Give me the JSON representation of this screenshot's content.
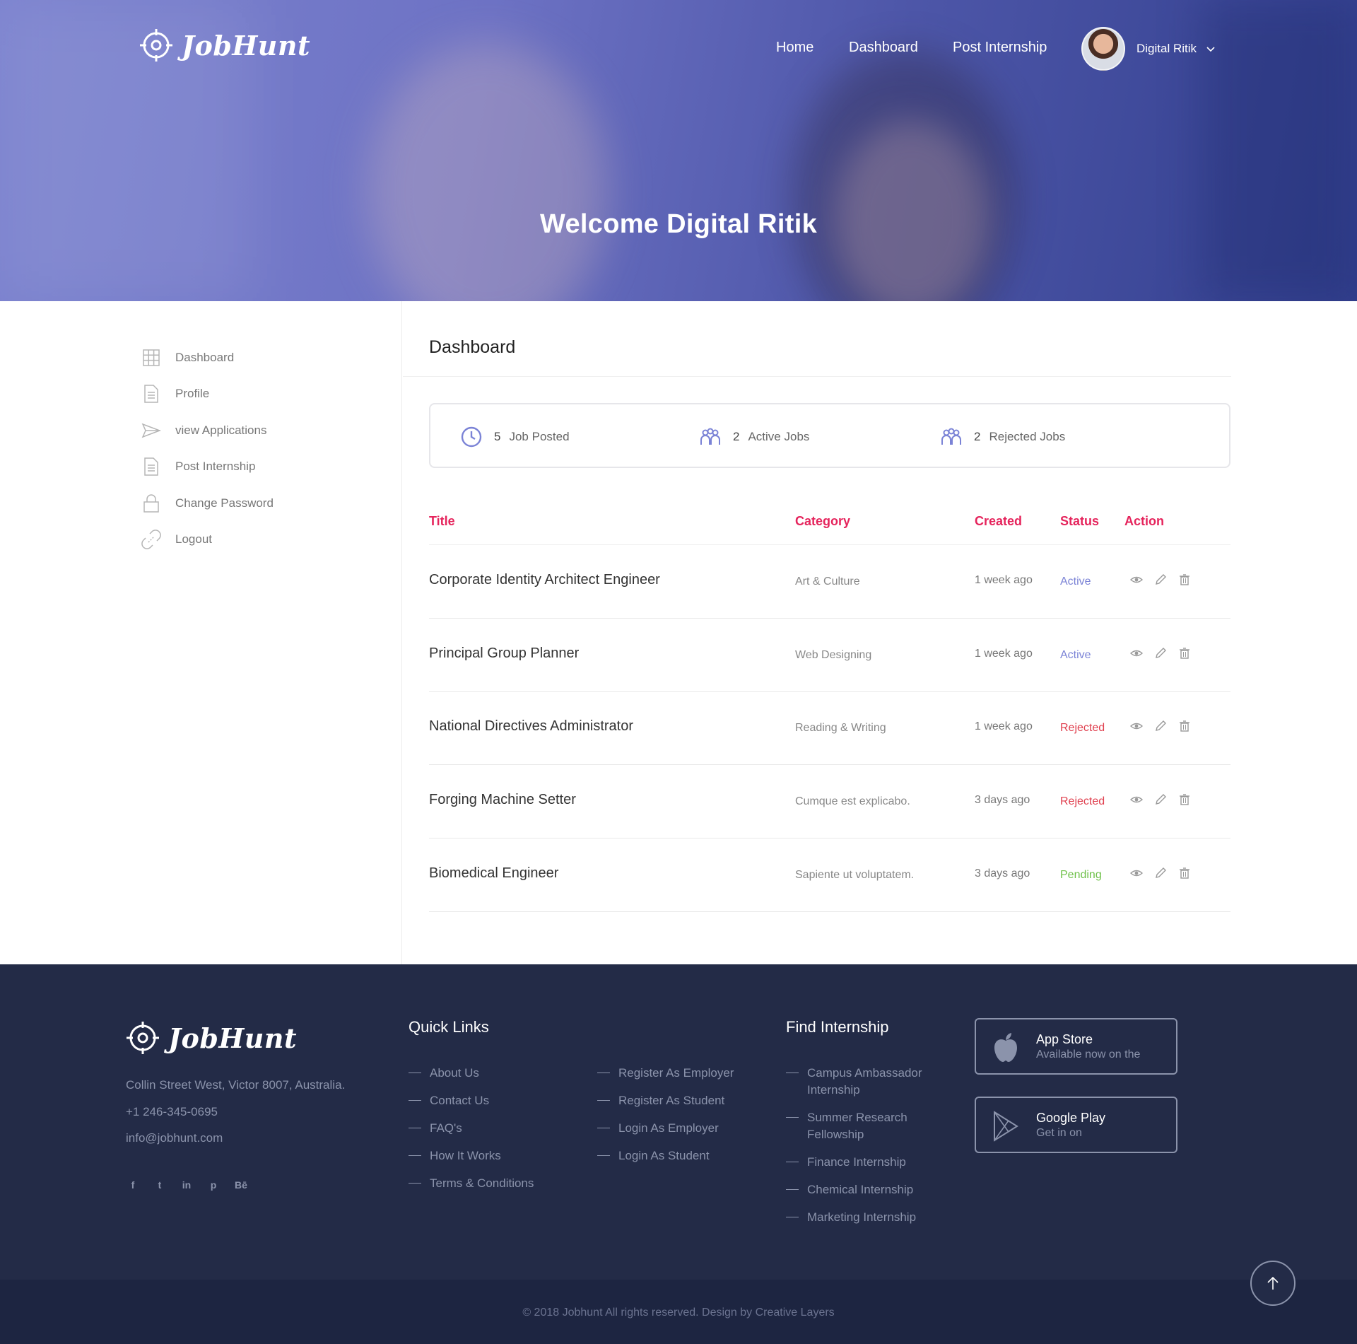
{
  "brand": {
    "name": "JobHunt"
  },
  "nav": {
    "home": "Home",
    "dashboard": "Dashboard",
    "post_internship": "Post Internship"
  },
  "user": {
    "name": "Digital Ritik"
  },
  "hero": {
    "welcome": "Welcome Digital Ritik"
  },
  "sidebar": {
    "items": [
      {
        "label": "Dashboard",
        "icon": "grid-icon"
      },
      {
        "label": "Profile",
        "icon": "document-icon"
      },
      {
        "label": "view Applications",
        "icon": "paper-plane-icon"
      },
      {
        "label": "Post Internship",
        "icon": "document-icon"
      },
      {
        "label": "Change Password",
        "icon": "lock-icon"
      },
      {
        "label": "Logout",
        "icon": "broken-link-icon"
      }
    ]
  },
  "main": {
    "title": "Dashboard",
    "stats": [
      {
        "value": "5",
        "label": "Job Posted",
        "icon": "clock-icon"
      },
      {
        "value": "2",
        "label": "Active Jobs",
        "icon": "users-icon"
      },
      {
        "value": "2",
        "label": "Rejected Jobs",
        "icon": "users-icon"
      }
    ],
    "table": {
      "headers": {
        "title": "Title",
        "category": "Category",
        "created": "Created",
        "status": "Status",
        "action": "Action"
      },
      "rows": [
        {
          "title": "Corporate Identity Architect Engineer",
          "category": "Art & Culture",
          "created": "1 week ago",
          "status": "Active"
        },
        {
          "title": "Principal Group Planner",
          "category": "Web Designing",
          "created": "1 week ago",
          "status": "Active"
        },
        {
          "title": "National Directives Administrator",
          "category": "Reading & Writing",
          "created": "1 week ago",
          "status": "Rejected"
        },
        {
          "title": "Forging Machine Setter",
          "category": "Cumque est explicabo.",
          "created": "3 days ago",
          "status": "Rejected"
        },
        {
          "title": "Biomedical Engineer",
          "category": "Sapiente ut voluptatem.",
          "created": "3 days ago",
          "status": "Pending"
        }
      ],
      "action_icons": [
        "eye-icon",
        "pencil-icon",
        "trash-icon"
      ]
    }
  },
  "status_colors": {
    "Active": "#7b83d6",
    "Rejected": "#e0404f",
    "Pending": "#6fc14a"
  },
  "colors": {
    "accent": "#e5245c",
    "footer_bg": "#232b47",
    "stat_icon": "#7b83d6"
  },
  "footer": {
    "address": "Collin Street West, Victor 8007, Australia.",
    "phone": "+1 246-345-0695",
    "email": "info@jobhunt.com",
    "social": [
      "f",
      "t",
      "in",
      "p",
      "Bē"
    ],
    "quick_links_title": "Quick Links",
    "quick_links_col1": [
      "About Us",
      "Contact Us",
      "FAQ's",
      "How It Works",
      "Terms & Conditions"
    ],
    "quick_links_col2": [
      "Register As Employer",
      "Register As Student",
      "Login As Employer",
      "Login As Student"
    ],
    "find_title": "Find Internship",
    "find_links": [
      "Campus Ambassador Internship",
      "Summer Research Fellowship",
      "Finance Internship",
      "Chemical Internship",
      "Marketing Internship"
    ],
    "app_store": {
      "title": "App Store",
      "sub": "Available now on the"
    },
    "google_play": {
      "title": "Google Play",
      "sub": "Get in on"
    },
    "copyright": "© 2018 Jobhunt All rights reserved. Design by Creative Layers"
  }
}
